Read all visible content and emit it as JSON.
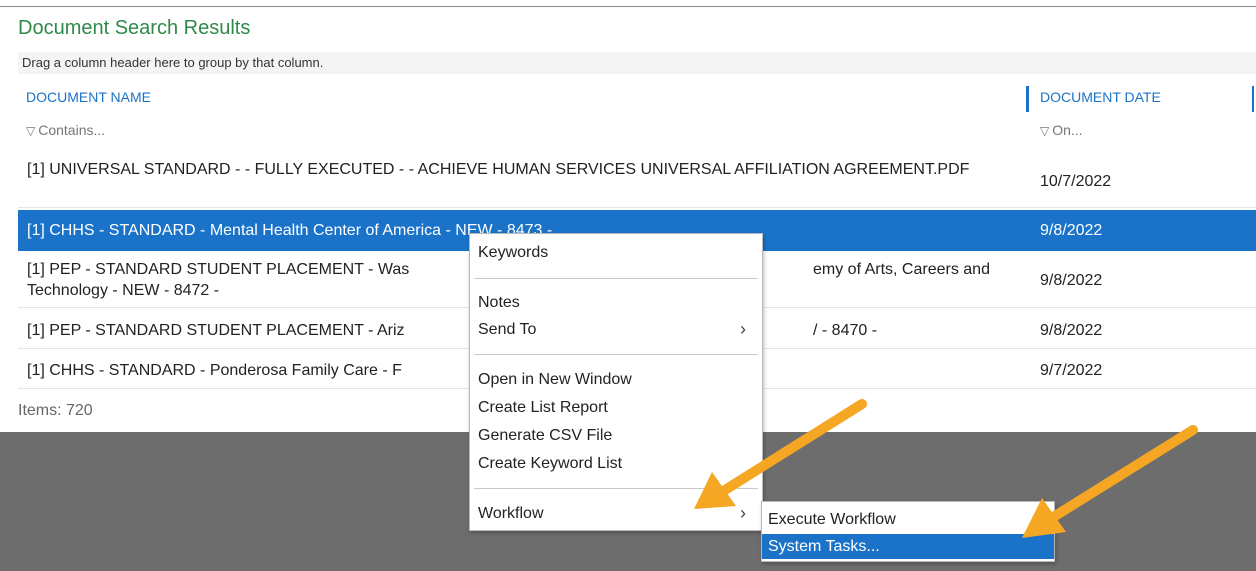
{
  "page": {
    "title": "Document Search Results"
  },
  "group_bar": {
    "text": "Drag a column header here to group by that column."
  },
  "columns": {
    "name": {
      "header": "DOCUMENT NAME",
      "filter": "Contains..."
    },
    "date": {
      "header": "DOCUMENT DATE",
      "filter": "On..."
    }
  },
  "filter_icon": "funnel-icon",
  "rows": [
    {
      "name": "[1] UNIVERSAL STANDARD - - FULLY EXECUTED - - ACHIEVE HUMAN SERVICES UNIVERSAL AFFILIATION AGREEMENT.PDF",
      "date": "10/7/2022"
    },
    {
      "name": "[1] CHHS - STANDARD - Mental Health Center of America - NEW - 8473 -",
      "date": "9/8/2022",
      "selected": true
    },
    {
      "name": "[1] PEP - STANDARD STUDENT PLACEMENT - Was",
      "name_tail": "emy of Arts, Careers and",
      "name_line2": "Technology - NEW - 8472 -",
      "date": "9/8/2022"
    },
    {
      "name": "[1] PEP - STANDARD STUDENT PLACEMENT - Ariz",
      "name_tail": "/ - 8470 -",
      "date": "9/8/2022"
    },
    {
      "name": "[1] CHHS - STANDARD - Ponderosa Family Care - F",
      "date": "9/7/2022"
    }
  ],
  "footer": {
    "items": "Items: 720"
  },
  "context_menu": {
    "keywords": "Keywords",
    "notes": "Notes",
    "send_to": "Send To",
    "open_new_window": "Open in New Window",
    "create_list_report": "Create List Report",
    "generate_csv": "Generate CSV File",
    "create_keyword_list": "Create Keyword List",
    "workflow": "Workflow"
  },
  "submenu": {
    "execute_workflow": "Execute Workflow",
    "system_tasks": "System Tasks..."
  },
  "colors": {
    "accent": "#1a73c9",
    "title": "#2e8a4a",
    "annotation_arrow": "#f5a623",
    "overlay": "#6d6d6d"
  }
}
